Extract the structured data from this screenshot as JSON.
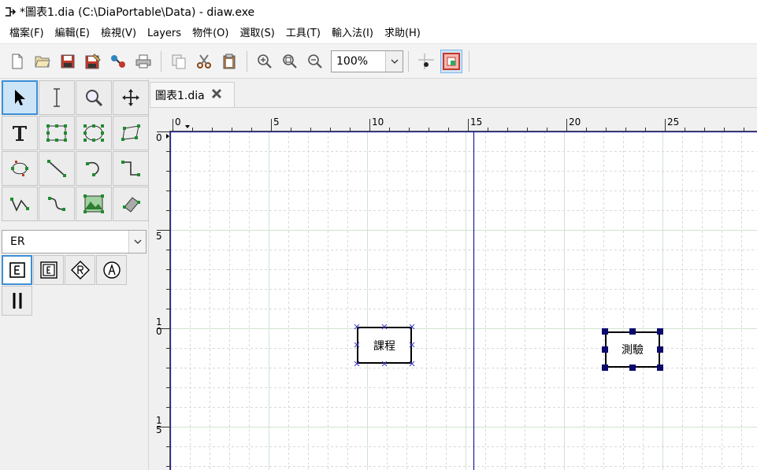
{
  "window": {
    "title": "*圖表1.dia (C:\\DiaPortable\\Data) - diaw.exe",
    "icon": "dia-app-icon"
  },
  "menu": {
    "items": [
      "檔案(F)",
      "編輯(E)",
      "檢視(V)",
      "Layers",
      "物件(O)",
      "選取(S)",
      "工具(T)",
      "輸入法(I)",
      "求助(H)"
    ]
  },
  "toolbar": {
    "zoom": "100%",
    "buttons": [
      "new-icon",
      "open-icon",
      "save-icon",
      "save-as-icon",
      "export-icon",
      "print-icon",
      "copy-icon",
      "cut-icon",
      "paste-icon",
      "zoom-in-icon",
      "zoom-fit-icon",
      "zoom-out-icon",
      "snap-to-grid-icon",
      "snap-to-objects-icon"
    ]
  },
  "tools": {
    "items": [
      "pointer-tool-icon",
      "text-edit-tool-icon",
      "magnify-tool-icon",
      "scroll-tool-icon",
      "text-tool-icon",
      "box-tool-icon",
      "ellipse-tool-icon",
      "polygon-tool-icon",
      "beziergon-tool-icon",
      "line-tool-icon",
      "arc-tool-icon",
      "zigzag-line-tool-icon",
      "polyline-tool-icon",
      "bezier-line-tool-icon",
      "image-tool-icon",
      "outline-tool-icon"
    ]
  },
  "sheet": {
    "selected": "ER",
    "objects": [
      "entity-icon",
      "weak-entity-icon",
      "relationship-icon",
      "attribute-icon",
      "participation-icon"
    ]
  },
  "document": {
    "tab_label": "圖表1.dia"
  },
  "ruler": {
    "h_labels": [
      "0",
      "5",
      "10",
      "15",
      "20",
      "25"
    ],
    "v_labels": [
      [
        "0"
      ],
      [
        "5"
      ],
      [
        "1",
        "0"
      ],
      [
        "1",
        "5"
      ]
    ]
  },
  "diagram": {
    "entities": [
      {
        "label": "課程",
        "selected": false
      },
      {
        "label": "測驗",
        "selected": true
      }
    ]
  },
  "colors": {
    "grid_major": "#cfe3cf",
    "grid_minor": "#d9d9d9",
    "page_break": "#1c1ca0",
    "selection_handle": "#0a0a6e"
  }
}
